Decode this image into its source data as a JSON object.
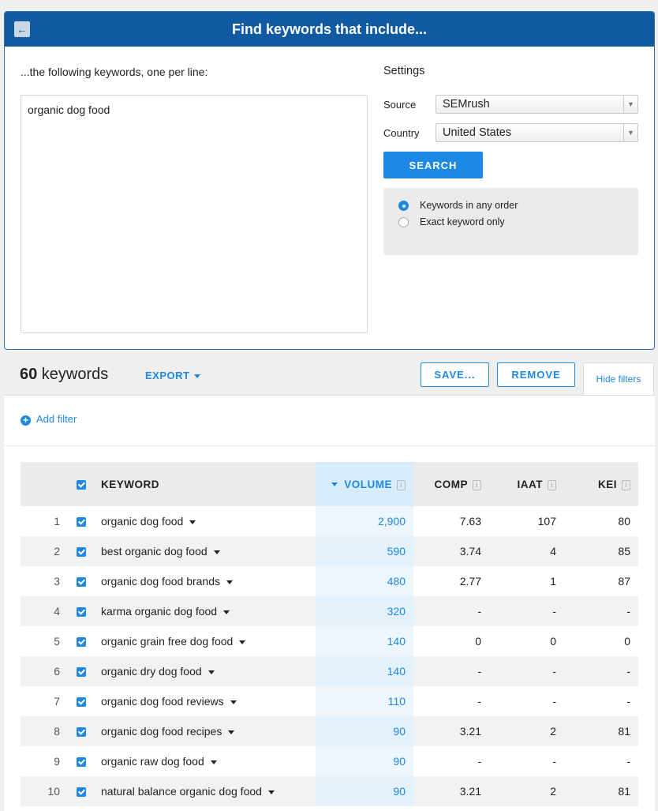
{
  "panel": {
    "title": "Find keywords that include...",
    "keywords_label": "...the following keywords, one per line:",
    "keywords_value": "organic dog food",
    "settings": {
      "title": "Settings",
      "source_label": "Source",
      "source_value": "SEMrush",
      "country_label": "Country",
      "country_value": "United States",
      "search_label": "SEARCH",
      "order_options": [
        {
          "label": "Keywords in any order",
          "selected": true
        },
        {
          "label": "Exact keyword only",
          "selected": false
        }
      ]
    }
  },
  "toolbar": {
    "count_number": "60",
    "count_label": " keywords",
    "export_label": "EXPORT",
    "save_label": "SAVE...",
    "remove_label": "REMOVE",
    "hide_filters_label": "Hide filters"
  },
  "filters": {
    "add_filter_label": "Add filter"
  },
  "table": {
    "headers": {
      "keyword": "KEYWORD",
      "volume": "VOLUME",
      "comp": "COMP",
      "iaat": "IAAT",
      "kei": "KEI"
    },
    "rows": [
      {
        "n": "1",
        "keyword": "organic dog food",
        "volume": "2,900",
        "comp": "7.63",
        "iaat": "107",
        "kei": "80"
      },
      {
        "n": "2",
        "keyword": "best organic dog food",
        "volume": "590",
        "comp": "3.74",
        "iaat": "4",
        "kei": "85"
      },
      {
        "n": "3",
        "keyword": "organic dog food brands",
        "volume": "480",
        "comp": "2.77",
        "iaat": "1",
        "kei": "87"
      },
      {
        "n": "4",
        "keyword": "karma organic dog food",
        "volume": "320",
        "comp": "-",
        "iaat": "-",
        "kei": "-"
      },
      {
        "n": "5",
        "keyword": "organic grain free dog food",
        "volume": "140",
        "comp": "0",
        "iaat": "0",
        "kei": "0"
      },
      {
        "n": "6",
        "keyword": "organic dry dog food",
        "volume": "140",
        "comp": "-",
        "iaat": "-",
        "kei": "-"
      },
      {
        "n": "7",
        "keyword": "organic dog food reviews",
        "volume": "110",
        "comp": "-",
        "iaat": "-",
        "kei": "-"
      },
      {
        "n": "8",
        "keyword": "organic dog food recipes",
        "volume": "90",
        "comp": "3.21",
        "iaat": "2",
        "kei": "81"
      },
      {
        "n": "9",
        "keyword": "organic raw dog food",
        "volume": "90",
        "comp": "-",
        "iaat": "-",
        "kei": "-"
      },
      {
        "n": "10",
        "keyword": "natural balance organic dog food",
        "volume": "90",
        "comp": "3.21",
        "iaat": "2",
        "kei": "81"
      }
    ]
  },
  "colors": {
    "header_bg": "#0f5aa0",
    "accent": "#1e88e5",
    "volume_col_bg": "#eef6fd"
  },
  "icons": {
    "back": "back-arrow-icon",
    "dropdown": "chevron-down-icon",
    "info": "info-icon",
    "add": "plus-circle-icon"
  }
}
